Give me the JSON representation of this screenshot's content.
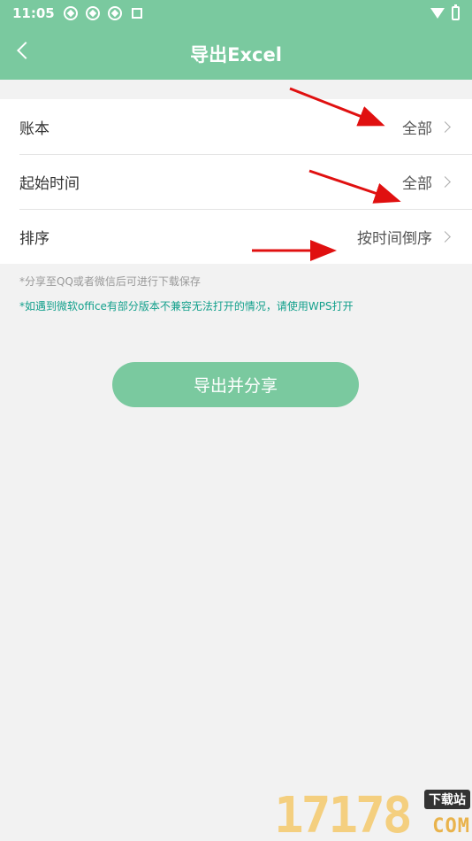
{
  "status_bar": {
    "time": "11:05"
  },
  "header": {
    "title": "导出Excel"
  },
  "rows": [
    {
      "label": "账本",
      "value": "全部"
    },
    {
      "label": "起始时间",
      "value": "全部"
    },
    {
      "label": "排序",
      "value": "按时间倒序"
    }
  ],
  "notes": {
    "share_note": "*分享至QQ或者微信后可进行下载保存",
    "compat_note": "*如遇到微软office有部分版本不兼容无法打开的情况，请使用WPS打开"
  },
  "actions": {
    "export_label": "导出并分享"
  },
  "watermark": {
    "digits": "17178",
    "badge": "下载站",
    "suffix": "COM"
  },
  "colors": {
    "accent": "#7ac99f",
    "note_teal": "#13a08c",
    "arrow_red": "#e01010"
  }
}
